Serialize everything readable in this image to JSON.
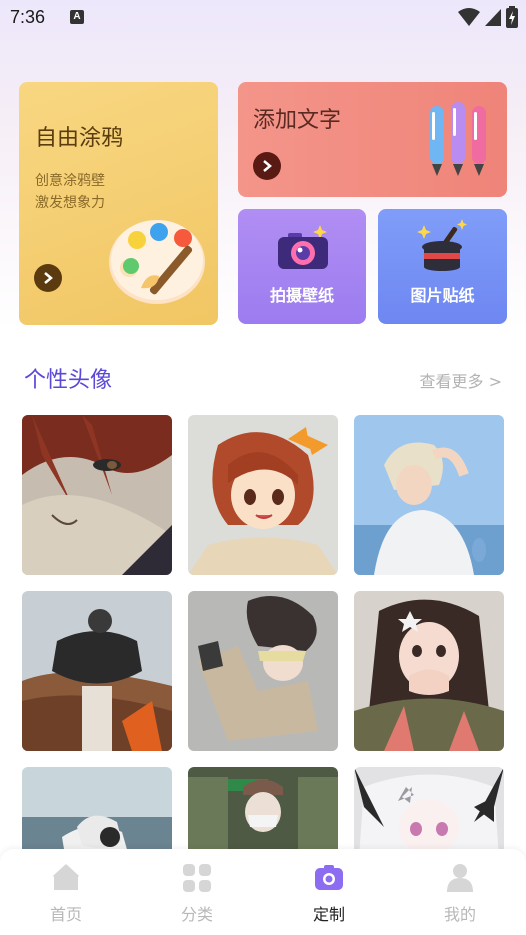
{
  "status_bar": {
    "time": "7:36",
    "a_icon": "A"
  },
  "cards": {
    "graffiti": {
      "title": "自由涂鸦",
      "desc_line1": "创意涂鸦壁",
      "desc_line2": "激发想象力",
      "icon": "palette-icon"
    },
    "add_text": {
      "title": "添加文字",
      "icon": "markers-icon"
    },
    "photo_wallpaper": {
      "label": "拍摄壁纸",
      "icon": "camera-icon"
    },
    "image_sticker": {
      "label": "图片贴纸",
      "icon": "magic-hat-icon"
    }
  },
  "avatar_section": {
    "title": "个性头像",
    "more": "查看更多 >"
  },
  "avatars": [
    {
      "desc": "anime red hair"
    },
    {
      "desc": "anime girl bow"
    },
    {
      "desc": "blond boy sea"
    },
    {
      "desc": "person cliff"
    },
    {
      "desc": "boy fur hat"
    },
    {
      "desc": "girl star clip"
    },
    {
      "desc": "gloved hands"
    },
    {
      "desc": "girl store"
    },
    {
      "desc": "anime white hair"
    }
  ],
  "bottom_nav": {
    "items": [
      {
        "label": "首页",
        "icon": "home-icon",
        "active": false
      },
      {
        "label": "分类",
        "icon": "grid-icon",
        "active": false
      },
      {
        "label": "定制",
        "icon": "camera-icon",
        "active": true
      },
      {
        "label": "我的",
        "icon": "user-icon",
        "active": false
      }
    ]
  },
  "colors": {
    "accent": "#7b5cf0",
    "section_title": "#5b48d8"
  }
}
